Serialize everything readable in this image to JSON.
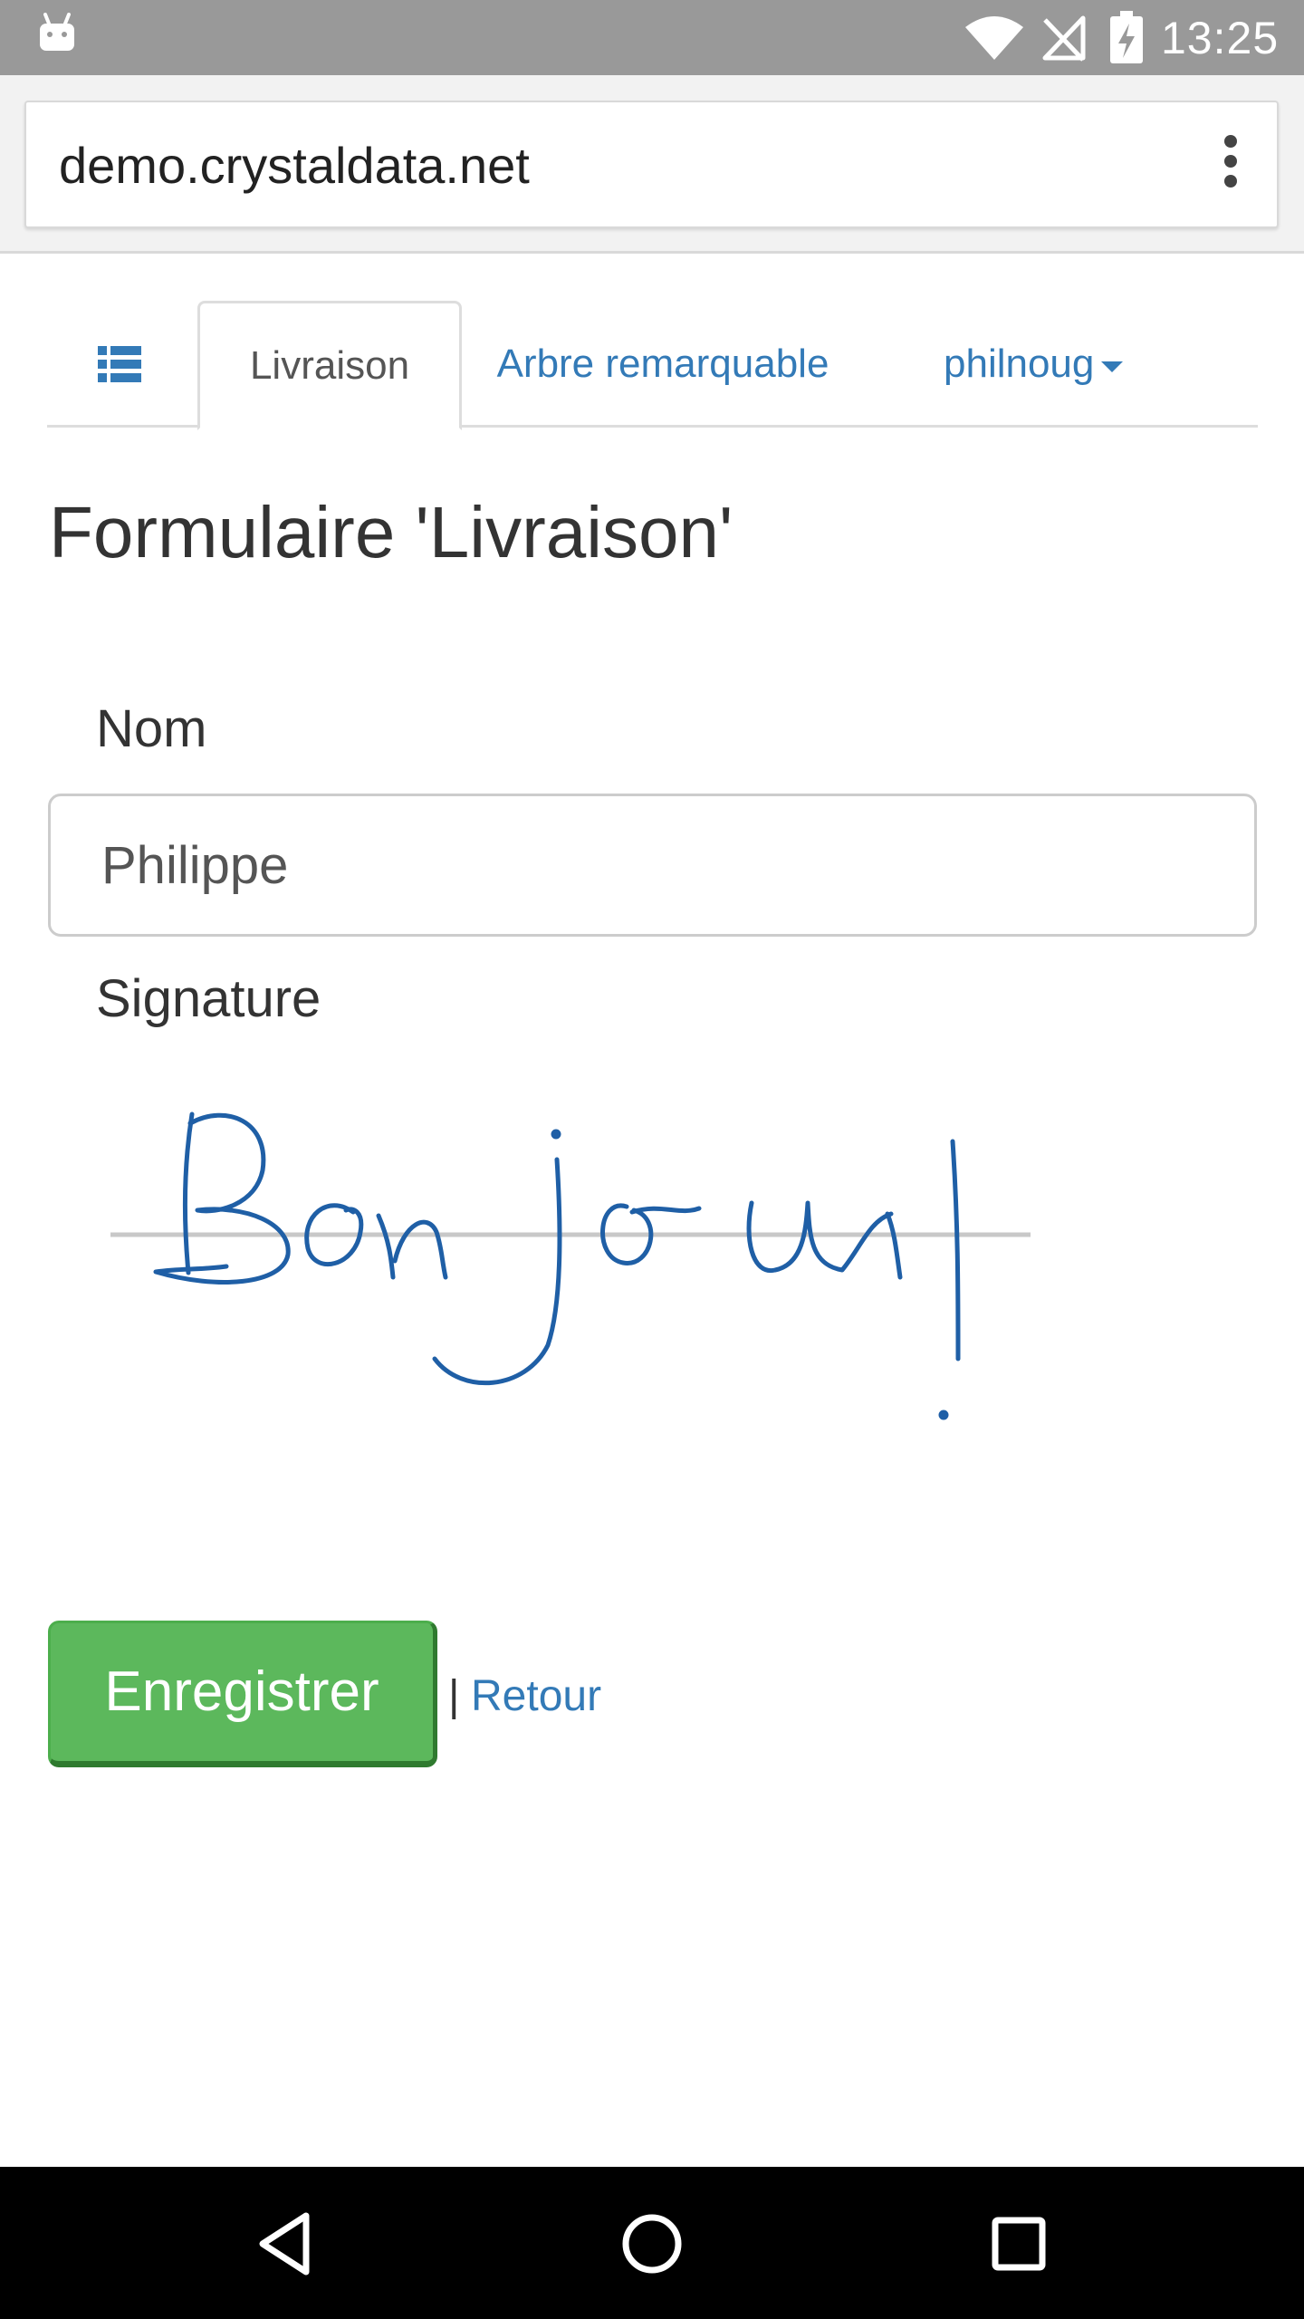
{
  "status_bar": {
    "time": "13:25",
    "icons": [
      "android-icon",
      "wifi-icon",
      "no-signal-icon",
      "battery-charging-icon"
    ]
  },
  "browser": {
    "url": "demo.crystaldata.net",
    "menu_icon": "more-vert-icon"
  },
  "tabs": {
    "list_icon": "list-icon",
    "items": [
      {
        "label": "Livraison",
        "active": true
      },
      {
        "label": "Arbre remarquable",
        "active": false
      },
      {
        "label": "philnoug",
        "active": false,
        "dropdown": true
      }
    ]
  },
  "page": {
    "title": "Formulaire 'Livraison'"
  },
  "form": {
    "nom_label": "Nom",
    "nom_value": "Philippe",
    "signature_label": "Signature",
    "signature_ink_color": "#1f5fa6",
    "save_label": "Enregistrer",
    "separator": "|",
    "back_label": "Retour"
  },
  "colors": {
    "link": "#337ab7",
    "success": "#5cb85c",
    "status_bar": "#999999"
  },
  "nav_bar": {
    "icons": [
      "back-triangle-icon",
      "home-circle-icon",
      "recents-square-icon"
    ]
  }
}
